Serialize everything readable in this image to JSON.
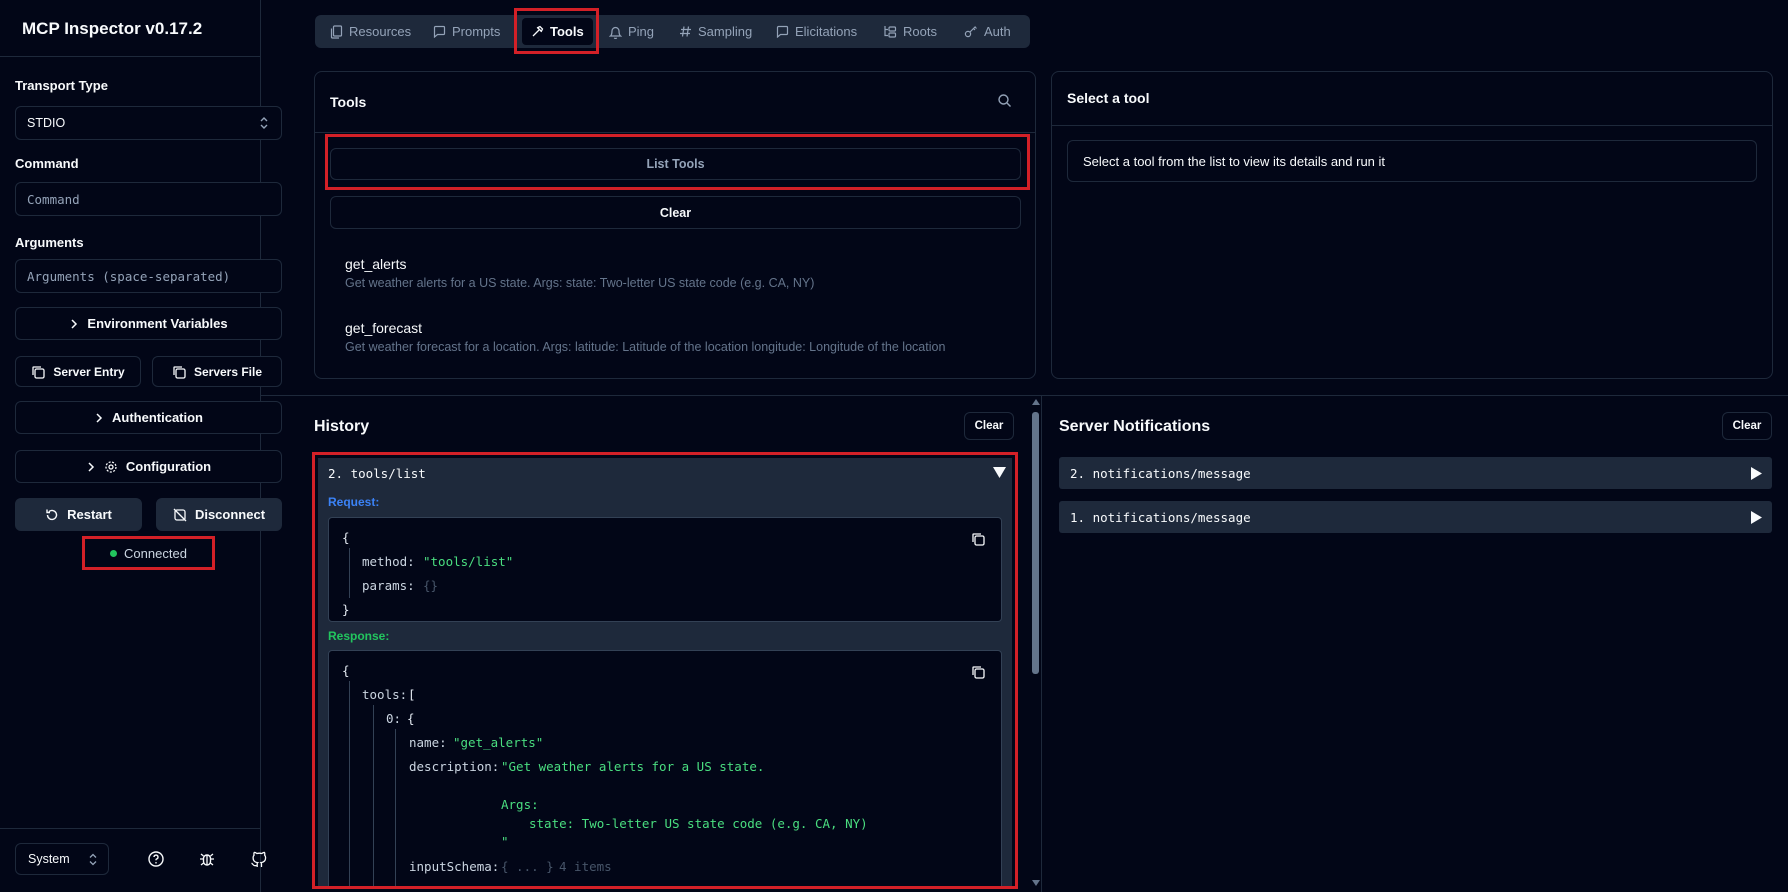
{
  "app": {
    "title": "MCP Inspector v0.17.2"
  },
  "sidebar": {
    "transport_label": "Transport Type",
    "transport_value": "STDIO",
    "command_label": "Command",
    "command_placeholder": "Command",
    "arguments_label": "Arguments",
    "arguments_placeholder": "Arguments (space-separated)",
    "env_vars": "Environment Variables",
    "server_entry": "Server Entry",
    "servers_file": "Servers File",
    "authentication": "Authentication",
    "configuration": "Configuration",
    "restart": "Restart",
    "disconnect": "Disconnect",
    "status": "Connected",
    "theme": "System"
  },
  "tabs": [
    {
      "label": "Resources",
      "icon": "files-icon"
    },
    {
      "label": "Prompts",
      "icon": "message-square-icon"
    },
    {
      "label": "Tools",
      "icon": "hammer-icon",
      "active": true
    },
    {
      "label": "Ping",
      "icon": "bell-icon"
    },
    {
      "label": "Sampling",
      "icon": "hash-icon"
    },
    {
      "label": "Elicitations",
      "icon": "message-square-icon"
    },
    {
      "label": "Roots",
      "icon": "folder-tree-icon"
    },
    {
      "label": "Auth",
      "icon": "key-icon"
    }
  ],
  "tools_panel": {
    "title": "Tools",
    "list_button": "List Tools",
    "clear_button": "Clear",
    "tools": [
      {
        "name": "get_alerts",
        "description": "Get weather alerts for a US state. Args: state: Two-letter US state code (e.g. CA, NY)"
      },
      {
        "name": "get_forecast",
        "description": "Get weather forecast for a location. Args: latitude: Latitude of the location longitude: Longitude of the location"
      }
    ]
  },
  "detail_panel": {
    "title": "Select a tool",
    "message": "Select a tool from the list to view its details and run it"
  },
  "history": {
    "title": "History",
    "clear": "Clear",
    "entry_title": "2. tools/list",
    "request_label": "Request:",
    "response_label": "Response:",
    "request": {
      "open": "{",
      "method_key": "method:",
      "method_val": "\"tools/list\"",
      "params_key": "params:",
      "params_val": "{}",
      "close": "}"
    },
    "response": {
      "open": "{",
      "tools_key": "tools:",
      "tools_open": "[",
      "idx_key": "0:",
      "idx_open": "{",
      "name_key": "name:",
      "name_val": "\"get_alerts\"",
      "desc_key": "description:",
      "desc_line1": "\"Get weather alerts for a US state.",
      "desc_line2": "Args:",
      "desc_line3": "state: Two-letter US state code (e.g. CA, NY)",
      "desc_line4": "\"",
      "schema_key": "inputSchema:",
      "schema_val": "{ ... }",
      "schema_count": "4 items"
    }
  },
  "notifications": {
    "title": "Server Notifications",
    "clear": "Clear",
    "items": [
      "2. notifications/message",
      "1. notifications/message"
    ]
  },
  "colors": {
    "accent_red": "#d32027",
    "bg": "#020617",
    "border": "#1e293b",
    "string_green": "#4ade80",
    "request_blue": "#3b82f6",
    "response_green": "#22c55e"
  }
}
